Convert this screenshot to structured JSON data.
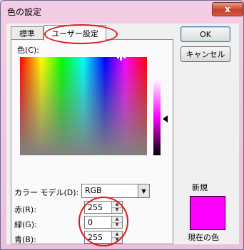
{
  "window": {
    "title": "色の設定",
    "close_glyph": "x"
  },
  "tabs": [
    {
      "label": "標準"
    },
    {
      "label": "ユーザー設定"
    }
  ],
  "color_picker": {
    "label": "色(C):"
  },
  "color_model": {
    "label": "カラー モデル(D):",
    "value": "RGB"
  },
  "rgb": {
    "red": {
      "label": "赤(R):",
      "value": "255"
    },
    "green": {
      "label": "緑(G):",
      "value": "0"
    },
    "blue": {
      "label": "青(B):",
      "value": "255"
    }
  },
  "buttons": {
    "ok": "OK",
    "cancel": "キャンセル"
  },
  "preview": {
    "new_label": "新規",
    "current_label": "現在の色",
    "color": "#ff00ff"
  },
  "colors": {
    "highlight": "#e01818",
    "dialog_bg": "#f0f0f0",
    "frame": "#eebfdc"
  }
}
